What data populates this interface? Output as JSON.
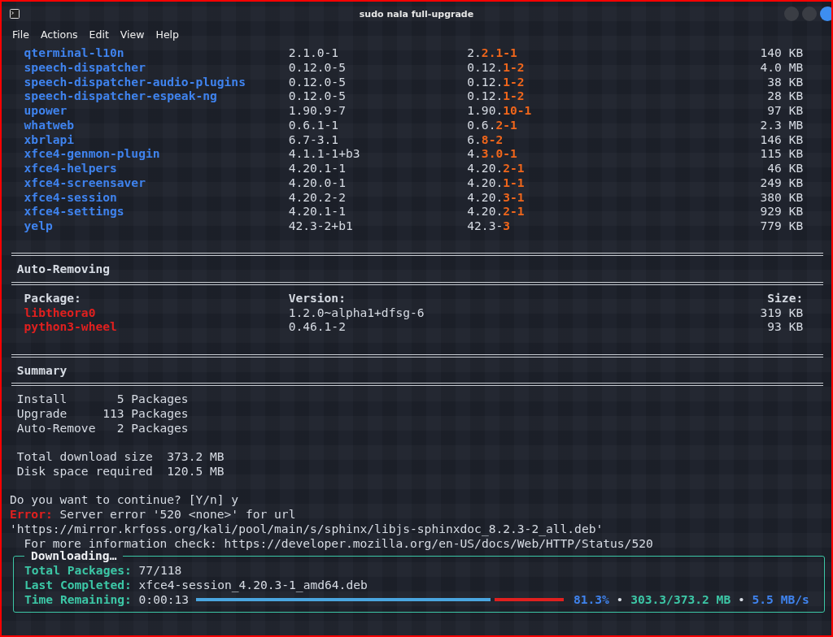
{
  "window": {
    "title": "sudo nala full-upgrade"
  },
  "menu": [
    "File",
    "Actions",
    "Edit",
    "View",
    "Help"
  ],
  "upgrade_rows": [
    {
      "package": "qterminal-l10n",
      "old_version": "2.1.0-1",
      "new_version_kept": "2.",
      "new_version_changed": "2.1-1",
      "size": "140 KB"
    },
    {
      "package": "speech-dispatcher",
      "old_version": "0.12.0-5",
      "new_version_kept": "0.12.",
      "new_version_changed": "1-2",
      "size": "4.0 MB"
    },
    {
      "package": "speech-dispatcher-audio-plugins",
      "old_version": "0.12.0-5",
      "new_version_kept": "0.12.",
      "new_version_changed": "1-2",
      "size": "38 KB"
    },
    {
      "package": "speech-dispatcher-espeak-ng",
      "old_version": "0.12.0-5",
      "new_version_kept": "0.12.",
      "new_version_changed": "1-2",
      "size": "28 KB"
    },
    {
      "package": "upower",
      "old_version": "1.90.9-7",
      "new_version_kept": "1.90.",
      "new_version_changed": "10-1",
      "size": "97 KB"
    },
    {
      "package": "whatweb",
      "old_version": "0.6.1-1",
      "new_version_kept": "0.6.",
      "new_version_changed": "2-1",
      "size": "2.3 MB"
    },
    {
      "package": "xbrlapi",
      "old_version": "6.7-3.1",
      "new_version_kept": "6.",
      "new_version_changed": "8-2",
      "size": "146 KB"
    },
    {
      "package": "xfce4-genmon-plugin",
      "old_version": "4.1.1-1+b3",
      "new_version_kept": "4.",
      "new_version_changed": "3.0-1",
      "size": "115 KB"
    },
    {
      "package": "xfce4-helpers",
      "old_version": "4.20.1-1",
      "new_version_kept": "4.20.",
      "new_version_changed": "2-1",
      "size": "46 KB"
    },
    {
      "package": "xfce4-screensaver",
      "old_version": "4.20.0-1",
      "new_version_kept": "4.20.",
      "new_version_changed": "1-1",
      "size": "249 KB"
    },
    {
      "package": "xfce4-session",
      "old_version": "4.20.2-2",
      "new_version_kept": "4.20.",
      "new_version_changed": "3-1",
      "size": "380 KB"
    },
    {
      "package": "xfce4-settings",
      "old_version": "4.20.1-1",
      "new_version_kept": "4.20.",
      "new_version_changed": "2-1",
      "size": "929 KB"
    },
    {
      "package": "yelp",
      "old_version": "42.3-2+b1",
      "new_version_kept": "42.3-",
      "new_version_changed": "3",
      "size": "779 KB"
    }
  ],
  "auto_removing": {
    "title": "Auto-Removing",
    "headers": {
      "package": "Package:",
      "version": "Version:",
      "size": "Size:"
    },
    "rows": [
      {
        "package": "libtheora0",
        "version": "1.2.0~alpha1+dfsg-6",
        "size": "319 KB"
      },
      {
        "package": "python3-wheel",
        "version": "0.46.1-2",
        "size": "93 KB"
      }
    ]
  },
  "summary": {
    "title": "Summary",
    "counts": [
      {
        "label": "Install",
        "count": "5",
        "unit": "Packages"
      },
      {
        "label": "Upgrade",
        "count": "113",
        "unit": "Packages"
      },
      {
        "label": "Auto-Remove",
        "count": "2",
        "unit": "Packages"
      }
    ],
    "totals": [
      {
        "label": "Total download size",
        "value": "373.2 MB"
      },
      {
        "label": "Disk space required",
        "value": "120.5 MB"
      }
    ]
  },
  "prompt": "Do you want to continue? [Y/n] y",
  "error": {
    "label": "Error:",
    "message": "Server error '520 <none>' for url",
    "url": "'https://mirror.krfoss.org/kali/pool/main/s/sphinx/libjs-sphinxdoc_8.2.3-2_all.deb'",
    "info": "For more information check: https://developer.mozilla.org/en-US/docs/Web/HTTP/Status/520"
  },
  "downloading": {
    "title": "Downloading…",
    "fields": [
      {
        "label": "Total Packages:",
        "value": "77/118"
      },
      {
        "label": "Last Completed:",
        "value": "xfce4-session_4.20.3-1_amd64.deb"
      },
      {
        "label": "Time Remaining:",
        "value": "0:00:13"
      }
    ],
    "progress": {
      "level": 0.813,
      "percent": "81.3%",
      "separator_1": "•",
      "transferred": "303.3/373.2 MB",
      "separator_2": "•",
      "speed": "5.5 MB/s"
    }
  }
}
